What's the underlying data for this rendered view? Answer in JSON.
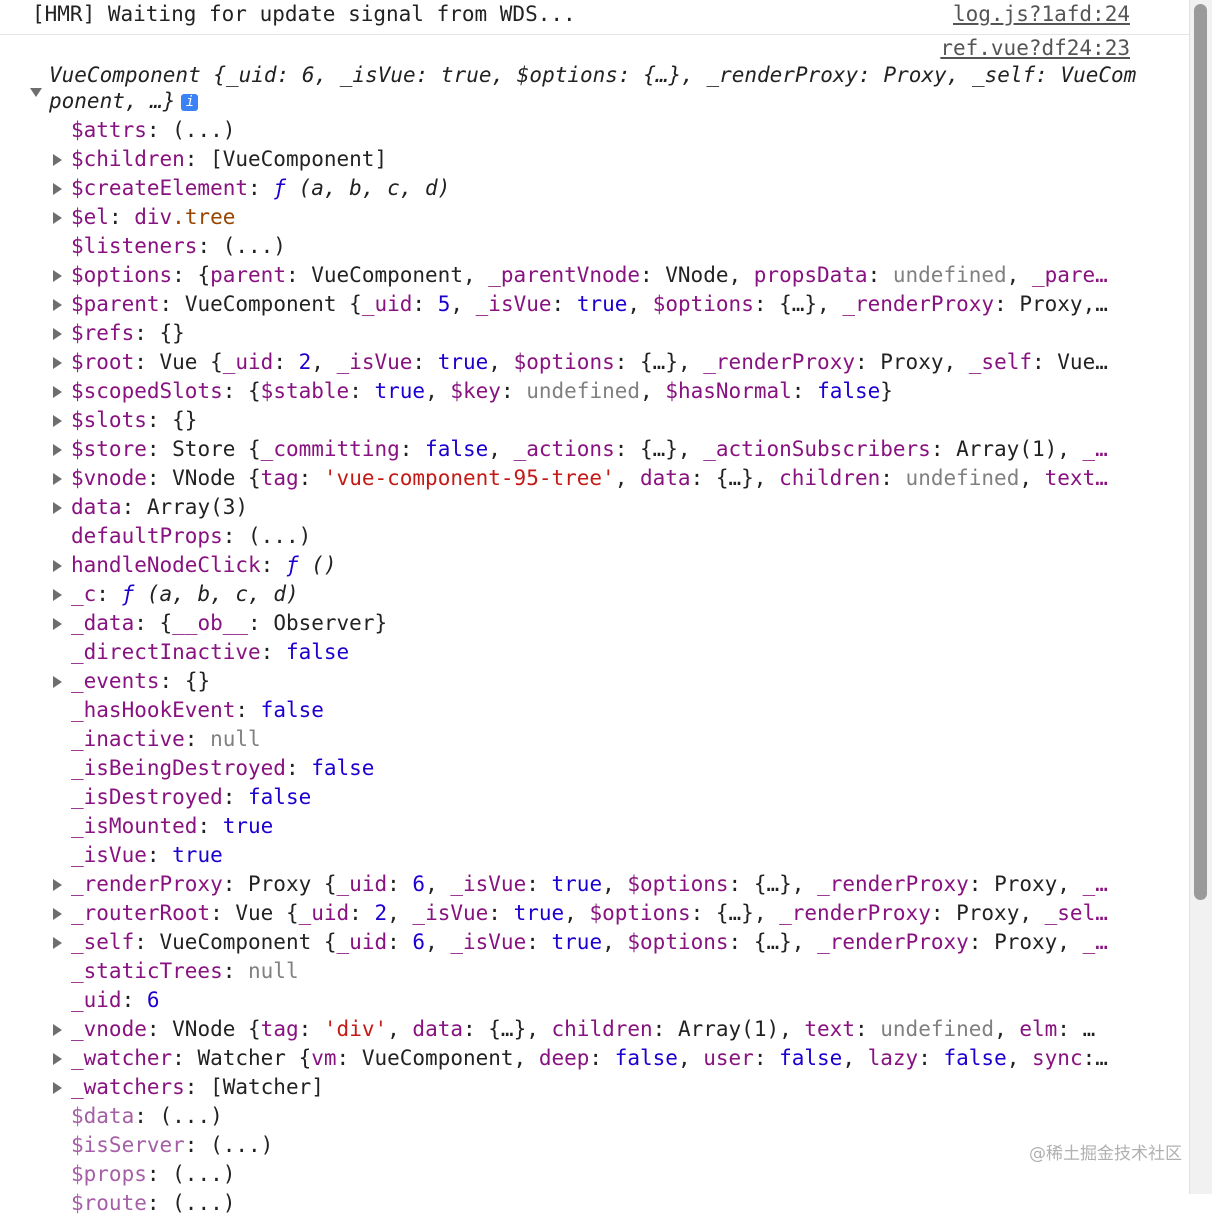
{
  "console": {
    "hmr_message": "[HMR] Waiting for update signal from WDS...",
    "hmr_source": "log.js?1afd:24",
    "log_source": "ref.vue?df24:23"
  },
  "object_head": {
    "text": "VueComponent {_uid: 6, _isVue: true, $options: {…}, _renderProxy: Proxy, _self: VueComponent, …}",
    "info_icon": "i"
  },
  "properties": [
    {
      "key": "$attrs",
      "expandable": false,
      "dim": false,
      "parts": [
        {
          "t": "plain",
          "v": "(...)"
        }
      ]
    },
    {
      "key": "$children",
      "expandable": true,
      "dim": false,
      "parts": [
        {
          "t": "plain",
          "v": "[VueComponent]"
        }
      ]
    },
    {
      "key": "$createElement",
      "expandable": true,
      "dim": false,
      "parts": [
        {
          "t": "fn",
          "v": "ƒ"
        },
        {
          "t": "plain",
          "v": " (a, b, c, d)",
          "italic": true
        }
      ]
    },
    {
      "key": "$el",
      "expandable": true,
      "dim": false,
      "parts": [
        {
          "t": "dom",
          "v": "div"
        },
        {
          "t": "domc",
          "v": ".tree"
        }
      ]
    },
    {
      "key": "$listeners",
      "expandable": false,
      "dim": false,
      "parts": [
        {
          "t": "plain",
          "v": "(...)"
        }
      ]
    },
    {
      "key": "$options",
      "expandable": true,
      "dim": false,
      "parts": [
        {
          "t": "plain",
          "v": "{"
        },
        {
          "t": "k",
          "v": "parent"
        },
        {
          "t": "plain",
          "v": ": VueComponent, "
        },
        {
          "t": "k",
          "v": "_parentVnode"
        },
        {
          "t": "plain",
          "v": ": VNode, "
        },
        {
          "t": "k",
          "v": "propsData"
        },
        {
          "t": "plain",
          "v": ": "
        },
        {
          "t": "null",
          "v": "undefined"
        },
        {
          "t": "plain",
          "v": ", "
        },
        {
          "t": "k",
          "v": "_pare…"
        }
      ]
    },
    {
      "key": "$parent",
      "expandable": true,
      "dim": false,
      "parts": [
        {
          "t": "plain",
          "v": "VueComponent {"
        },
        {
          "t": "k",
          "v": "_uid"
        },
        {
          "t": "plain",
          "v": ": "
        },
        {
          "t": "num",
          "v": "5"
        },
        {
          "t": "plain",
          "v": ", "
        },
        {
          "t": "k",
          "v": "_isVue"
        },
        {
          "t": "plain",
          "v": ": "
        },
        {
          "t": "bool",
          "v": "true"
        },
        {
          "t": "plain",
          "v": ", "
        },
        {
          "t": "k",
          "v": "$options"
        },
        {
          "t": "plain",
          "v": ": {…}, "
        },
        {
          "t": "k",
          "v": "_renderProxy"
        },
        {
          "t": "plain",
          "v": ": Proxy,…"
        }
      ]
    },
    {
      "key": "$refs",
      "expandable": true,
      "dim": false,
      "parts": [
        {
          "t": "plain",
          "v": "{}"
        }
      ]
    },
    {
      "key": "$root",
      "expandable": true,
      "dim": false,
      "parts": [
        {
          "t": "plain",
          "v": "Vue {"
        },
        {
          "t": "k",
          "v": "_uid"
        },
        {
          "t": "plain",
          "v": ": "
        },
        {
          "t": "num",
          "v": "2"
        },
        {
          "t": "plain",
          "v": ", "
        },
        {
          "t": "k",
          "v": "_isVue"
        },
        {
          "t": "plain",
          "v": ": "
        },
        {
          "t": "bool",
          "v": "true"
        },
        {
          "t": "plain",
          "v": ", "
        },
        {
          "t": "k",
          "v": "$options"
        },
        {
          "t": "plain",
          "v": ": {…}, "
        },
        {
          "t": "k",
          "v": "_renderProxy"
        },
        {
          "t": "plain",
          "v": ": Proxy, "
        },
        {
          "t": "k",
          "v": "_self"
        },
        {
          "t": "plain",
          "v": ": Vue…"
        }
      ]
    },
    {
      "key": "$scopedSlots",
      "expandable": true,
      "dim": false,
      "parts": [
        {
          "t": "plain",
          "v": "{"
        },
        {
          "t": "k",
          "v": "$stable"
        },
        {
          "t": "plain",
          "v": ": "
        },
        {
          "t": "bool",
          "v": "true"
        },
        {
          "t": "plain",
          "v": ", "
        },
        {
          "t": "k",
          "v": "$key"
        },
        {
          "t": "plain",
          "v": ": "
        },
        {
          "t": "null",
          "v": "undefined"
        },
        {
          "t": "plain",
          "v": ", "
        },
        {
          "t": "k",
          "v": "$hasNormal"
        },
        {
          "t": "plain",
          "v": ": "
        },
        {
          "t": "bool",
          "v": "false"
        },
        {
          "t": "plain",
          "v": "}"
        }
      ]
    },
    {
      "key": "$slots",
      "expandable": true,
      "dim": false,
      "parts": [
        {
          "t": "plain",
          "v": "{}"
        }
      ]
    },
    {
      "key": "$store",
      "expandable": true,
      "dim": false,
      "parts": [
        {
          "t": "plain",
          "v": "Store {"
        },
        {
          "t": "k",
          "v": "_committing"
        },
        {
          "t": "plain",
          "v": ": "
        },
        {
          "t": "bool",
          "v": "false"
        },
        {
          "t": "plain",
          "v": ", "
        },
        {
          "t": "k",
          "v": "_actions"
        },
        {
          "t": "plain",
          "v": ": {…}, "
        },
        {
          "t": "k",
          "v": "_actionSubscribers"
        },
        {
          "t": "plain",
          "v": ": Array(1), "
        },
        {
          "t": "k",
          "v": "_…"
        }
      ]
    },
    {
      "key": "$vnode",
      "expandable": true,
      "dim": false,
      "parts": [
        {
          "t": "plain",
          "v": "VNode {"
        },
        {
          "t": "k",
          "v": "tag"
        },
        {
          "t": "plain",
          "v": ": "
        },
        {
          "t": "str",
          "v": "'vue-component-95-tree'"
        },
        {
          "t": "plain",
          "v": ", "
        },
        {
          "t": "k",
          "v": "data"
        },
        {
          "t": "plain",
          "v": ": {…}, "
        },
        {
          "t": "k",
          "v": "children"
        },
        {
          "t": "plain",
          "v": ": "
        },
        {
          "t": "null",
          "v": "undefined"
        },
        {
          "t": "plain",
          "v": ", "
        },
        {
          "t": "k",
          "v": "text…"
        }
      ]
    },
    {
      "key": "data",
      "expandable": true,
      "dim": false,
      "parts": [
        {
          "t": "plain",
          "v": "Array(3)"
        }
      ]
    },
    {
      "key": "defaultProps",
      "expandable": false,
      "dim": false,
      "parts": [
        {
          "t": "plain",
          "v": "(...)"
        }
      ]
    },
    {
      "key": "handleNodeClick",
      "expandable": true,
      "dim": false,
      "parts": [
        {
          "t": "fn",
          "v": "ƒ"
        },
        {
          "t": "plain",
          "v": " ()",
          "italic": true
        }
      ]
    },
    {
      "key": "_c",
      "expandable": true,
      "dim": false,
      "parts": [
        {
          "t": "fn",
          "v": "ƒ"
        },
        {
          "t": "plain",
          "v": " (a, b, c, d)",
          "italic": true
        }
      ]
    },
    {
      "key": "_data",
      "expandable": true,
      "dim": false,
      "parts": [
        {
          "t": "plain",
          "v": "{"
        },
        {
          "t": "k",
          "v": "__ob__"
        },
        {
          "t": "plain",
          "v": ": Observer}"
        }
      ]
    },
    {
      "key": "_directInactive",
      "expandable": false,
      "dim": false,
      "parts": [
        {
          "t": "bool",
          "v": "false"
        }
      ]
    },
    {
      "key": "_events",
      "expandable": true,
      "dim": false,
      "parts": [
        {
          "t": "plain",
          "v": "{}"
        }
      ]
    },
    {
      "key": "_hasHookEvent",
      "expandable": false,
      "dim": false,
      "parts": [
        {
          "t": "bool",
          "v": "false"
        }
      ]
    },
    {
      "key": "_inactive",
      "expandable": false,
      "dim": false,
      "parts": [
        {
          "t": "null",
          "v": "null"
        }
      ]
    },
    {
      "key": "_isBeingDestroyed",
      "expandable": false,
      "dim": false,
      "parts": [
        {
          "t": "bool",
          "v": "false"
        }
      ]
    },
    {
      "key": "_isDestroyed",
      "expandable": false,
      "dim": false,
      "parts": [
        {
          "t": "bool",
          "v": "false"
        }
      ]
    },
    {
      "key": "_isMounted",
      "expandable": false,
      "dim": false,
      "parts": [
        {
          "t": "bool",
          "v": "true"
        }
      ]
    },
    {
      "key": "_isVue",
      "expandable": false,
      "dim": false,
      "parts": [
        {
          "t": "bool",
          "v": "true"
        }
      ]
    },
    {
      "key": "_renderProxy",
      "expandable": true,
      "dim": false,
      "parts": [
        {
          "t": "plain",
          "v": "Proxy {"
        },
        {
          "t": "k",
          "v": "_uid"
        },
        {
          "t": "plain",
          "v": ": "
        },
        {
          "t": "num",
          "v": "6"
        },
        {
          "t": "plain",
          "v": ", "
        },
        {
          "t": "k",
          "v": "_isVue"
        },
        {
          "t": "plain",
          "v": ": "
        },
        {
          "t": "bool",
          "v": "true"
        },
        {
          "t": "plain",
          "v": ", "
        },
        {
          "t": "k",
          "v": "$options"
        },
        {
          "t": "plain",
          "v": ": {…}, "
        },
        {
          "t": "k",
          "v": "_renderProxy"
        },
        {
          "t": "plain",
          "v": ": Proxy, "
        },
        {
          "t": "k",
          "v": "_…"
        }
      ]
    },
    {
      "key": "_routerRoot",
      "expandable": true,
      "dim": false,
      "parts": [
        {
          "t": "plain",
          "v": "Vue {"
        },
        {
          "t": "k",
          "v": "_uid"
        },
        {
          "t": "plain",
          "v": ": "
        },
        {
          "t": "num",
          "v": "2"
        },
        {
          "t": "plain",
          "v": ", "
        },
        {
          "t": "k",
          "v": "_isVue"
        },
        {
          "t": "plain",
          "v": ": "
        },
        {
          "t": "bool",
          "v": "true"
        },
        {
          "t": "plain",
          "v": ", "
        },
        {
          "t": "k",
          "v": "$options"
        },
        {
          "t": "plain",
          "v": ": {…}, "
        },
        {
          "t": "k",
          "v": "_renderProxy"
        },
        {
          "t": "plain",
          "v": ": Proxy, "
        },
        {
          "t": "k",
          "v": "_sel…"
        }
      ]
    },
    {
      "key": "_self",
      "expandable": true,
      "dim": false,
      "parts": [
        {
          "t": "plain",
          "v": "VueComponent {"
        },
        {
          "t": "k",
          "v": "_uid"
        },
        {
          "t": "plain",
          "v": ": "
        },
        {
          "t": "num",
          "v": "6"
        },
        {
          "t": "plain",
          "v": ", "
        },
        {
          "t": "k",
          "v": "_isVue"
        },
        {
          "t": "plain",
          "v": ": "
        },
        {
          "t": "bool",
          "v": "true"
        },
        {
          "t": "plain",
          "v": ", "
        },
        {
          "t": "k",
          "v": "$options"
        },
        {
          "t": "plain",
          "v": ": {…}, "
        },
        {
          "t": "k",
          "v": "_renderProxy"
        },
        {
          "t": "plain",
          "v": ": Proxy, "
        },
        {
          "t": "k",
          "v": "_…"
        }
      ]
    },
    {
      "key": "_staticTrees",
      "expandable": false,
      "dim": false,
      "parts": [
        {
          "t": "null",
          "v": "null"
        }
      ]
    },
    {
      "key": "_uid",
      "expandable": false,
      "dim": false,
      "parts": [
        {
          "t": "num",
          "v": "6"
        }
      ]
    },
    {
      "key": "_vnode",
      "expandable": true,
      "dim": false,
      "parts": [
        {
          "t": "plain",
          "v": "VNode {"
        },
        {
          "t": "k",
          "v": "tag"
        },
        {
          "t": "plain",
          "v": ": "
        },
        {
          "t": "str",
          "v": "'div'"
        },
        {
          "t": "plain",
          "v": ", "
        },
        {
          "t": "k",
          "v": "data"
        },
        {
          "t": "plain",
          "v": ": {…}, "
        },
        {
          "t": "k",
          "v": "children"
        },
        {
          "t": "plain",
          "v": ": Array(1), "
        },
        {
          "t": "k",
          "v": "text"
        },
        {
          "t": "plain",
          "v": ": "
        },
        {
          "t": "null",
          "v": "undefined"
        },
        {
          "t": "plain",
          "v": ", "
        },
        {
          "t": "k",
          "v": "elm"
        },
        {
          "t": "plain",
          "v": ": …"
        }
      ]
    },
    {
      "key": "_watcher",
      "expandable": true,
      "dim": false,
      "parts": [
        {
          "t": "plain",
          "v": "Watcher {"
        },
        {
          "t": "k",
          "v": "vm"
        },
        {
          "t": "plain",
          "v": ": VueComponent, "
        },
        {
          "t": "k",
          "v": "deep"
        },
        {
          "t": "plain",
          "v": ": "
        },
        {
          "t": "bool",
          "v": "false"
        },
        {
          "t": "plain",
          "v": ", "
        },
        {
          "t": "k",
          "v": "user"
        },
        {
          "t": "plain",
          "v": ": "
        },
        {
          "t": "bool",
          "v": "false"
        },
        {
          "t": "plain",
          "v": ", "
        },
        {
          "t": "k",
          "v": "lazy"
        },
        {
          "t": "plain",
          "v": ": "
        },
        {
          "t": "bool",
          "v": "false"
        },
        {
          "t": "plain",
          "v": ", "
        },
        {
          "t": "k",
          "v": "sync"
        },
        {
          "t": "plain",
          "v": ":…"
        }
      ]
    },
    {
      "key": "_watchers",
      "expandable": true,
      "dim": false,
      "parts": [
        {
          "t": "plain",
          "v": "[Watcher]"
        }
      ]
    },
    {
      "key": "$data",
      "expandable": false,
      "dim": true,
      "parts": [
        {
          "t": "plain",
          "v": "(...)"
        }
      ]
    },
    {
      "key": "$isServer",
      "expandable": false,
      "dim": true,
      "parts": [
        {
          "t": "plain",
          "v": "(...)"
        }
      ]
    },
    {
      "key": "$props",
      "expandable": false,
      "dim": true,
      "parts": [
        {
          "t": "plain",
          "v": "(...)"
        }
      ]
    },
    {
      "key": "$route",
      "expandable": false,
      "dim": true,
      "parts": [
        {
          "t": "plain",
          "v": "(...)"
        }
      ]
    }
  ],
  "watermark": "@稀土掘金技术社区",
  "icons": {
    "expand": "triangle-right-icon",
    "expanded": "triangle-down-icon",
    "info": "info-icon"
  }
}
